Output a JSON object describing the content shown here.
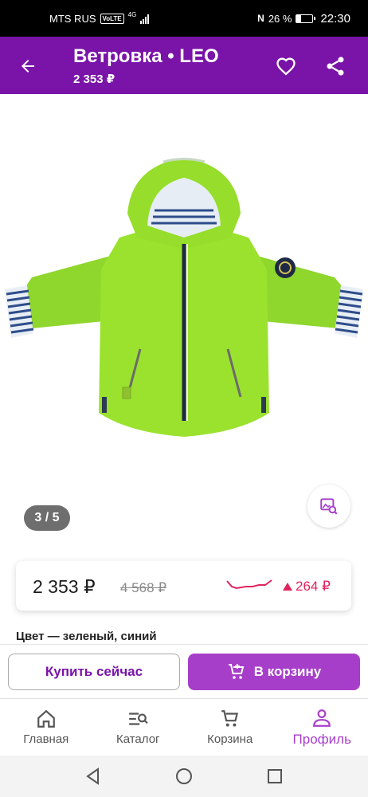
{
  "status_bar": {
    "carrier": "MTS RUS",
    "volte": "VoLTE",
    "network": "4G",
    "nfc": "N",
    "battery_percent": "26 %",
    "battery_level": 0.26,
    "time": "22:30"
  },
  "app_bar": {
    "title": "Ветровка • LEO",
    "price": "2 353 ₽",
    "icons": {
      "back": "arrow-left-icon",
      "favorite": "heart-outline-icon",
      "share": "share-icon"
    },
    "color": "#7a14a8"
  },
  "gallery": {
    "indicator": "3 / 5",
    "image": "lime-green-jacket",
    "search_icon": "image-search-icon"
  },
  "price_card": {
    "current": "2 353 ₽",
    "old": "4 568 ₽",
    "change": "264 ₽",
    "change_direction": "up",
    "accent": "#e0245e"
  },
  "product": {
    "color_label": "Цвет — зеленый, синий"
  },
  "actions": {
    "buy_now": "Купить сейчас",
    "add_to_cart": "В корзину",
    "cart_color": "#a73ec9"
  },
  "bottom_nav": {
    "items": [
      {
        "label": "Главная",
        "icon": "home-icon"
      },
      {
        "label": "Каталог",
        "icon": "catalog-search-icon"
      },
      {
        "label": "Корзина",
        "icon": "cart-icon"
      },
      {
        "label": "Профиль",
        "icon": "profile-icon",
        "active": true
      }
    ]
  }
}
